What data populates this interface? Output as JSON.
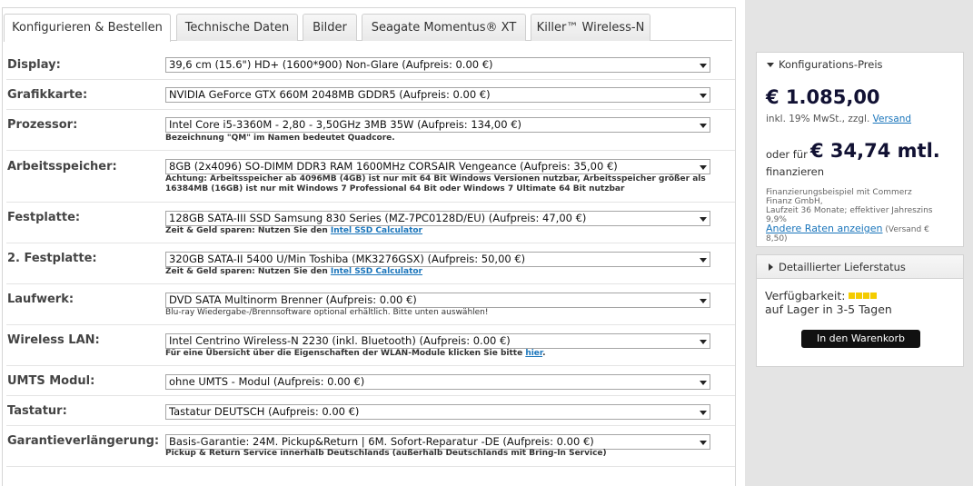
{
  "tabs": [
    {
      "label": "Konfigurieren & Bestellen"
    },
    {
      "label": "Technische Daten"
    },
    {
      "label": "Bilder"
    },
    {
      "label": "Seagate Momentus® XT"
    },
    {
      "label": "Killer™ Wireless-N"
    }
  ],
  "config": [
    {
      "label": "Display:",
      "value": "39,6 cm (15.6\") HD+ (1600*900) Non-Glare (Aufpreis: 0.00 €)"
    },
    {
      "label": "Grafikkarte:",
      "value": "NVIDIA GeForce GTX 660M 2048MB GDDR5 (Aufpreis: 0.00 €)"
    },
    {
      "label": "Prozessor:",
      "value": "Intel Core i5-3360M - 2,80 - 3,50GHz 3MB 35W (Aufpreis: 134,00 €)",
      "note": "Bezeichnung \"QM\" im Namen bedeutet Quadcore."
    },
    {
      "label": "Arbeitsspeicher:",
      "value": "8GB (2x4096) SO-DIMM DDR3 RAM 1600MHz CORSAIR Vengeance (Aufpreis: 35,00 €)",
      "note": "Achtung: Arbeitsspeicher ab 4096MB (4GB) ist nur mit 64 Bit Windows Versionen nutzbar, Arbeitsspeicher größer als 16384MB (16GB) ist nur mit Windows 7 Professional 64 Bit oder Windows 7 Ultimate 64 Bit nutzbar"
    },
    {
      "label": "Festplatte:",
      "value": "128GB SATA-III SSD Samsung 830 Series (MZ-7PC0128D/EU) (Aufpreis: 47,00 €)",
      "note": "Zeit & Geld sparen: Nutzen Sie den ",
      "link": "Intel SSD Calculator"
    },
    {
      "label": "2. Festplatte:",
      "value": "320GB SATA-II 5400 U/Min Toshiba (MK3276GSX) (Aufpreis: 50,00 €)",
      "note": "Zeit & Geld sparen: Nutzen Sie den ",
      "link": "Intel SSD Calculator"
    },
    {
      "label": "Laufwerk:",
      "value": "DVD SATA Multinorm Brenner (Aufpreis: 0.00 €)",
      "note": "Blu-ray Wiedergabe-/Brennsoftware optional erhältlich. Bitte unten auswählen!"
    },
    {
      "label": "Wireless LAN:",
      "value": "Intel Centrino Wireless-N 2230 (inkl. Bluetooth) (Aufpreis: 0.00 €)",
      "note": "Für eine Übersicht über die Eigenschaften der WLAN-Module klicken Sie bitte ",
      "link": "hier",
      "note_after": "."
    },
    {
      "label": "UMTS Modul:",
      "value": "ohne UMTS - Modul (Aufpreis: 0.00 €)"
    },
    {
      "label": "Tastatur:",
      "value": "Tastatur DEUTSCH (Aufpreis: 0.00 €)"
    },
    {
      "label": "Garantieverlängerung:",
      "value": "Basis-Garantie: 24M. Pickup&Return | 6M. Sofort-Reparatur -DE (Aufpreis: 0.00 €)",
      "note": "Pickup & Return Service innerhalb Deutschlands (außerhalb Deutschlands mit Bring-In Service)"
    }
  ],
  "price_box": {
    "title": "Konfigurations-Preis",
    "price": "€ 1.085,00",
    "tax_text": "inkl. 19% MwSt., zzgl. ",
    "shipping_link": "Versand",
    "finance_prefix": "oder für ",
    "monthly": "€ 34,74 mtl.",
    "finance_label": "finanzieren",
    "example_line1": "Finanzierungsbeispiel mit Commerz",
    "example_line2": "Finanz GmbH,",
    "example_line3": "Laufzeit 36 Monate; effektiver Jahreszins",
    "example_line4": "9,9%",
    "rates_link": "Andere Raten anzeigen",
    "rates_suffix": " (Versand €",
    "rates_suffix2": "8,50)"
  },
  "delivery_box": {
    "title": "Detaillierter Lieferstatus"
  },
  "availability": {
    "label": "Verfügbarkeit:",
    "level": 4,
    "status": "auf Lager in 3-5 Tagen"
  },
  "cart_button": "In den Warenkorb",
  "colors": {
    "accent_link": "#1a75bb",
    "button": "#111111",
    "availability": "#f4cc00"
  }
}
